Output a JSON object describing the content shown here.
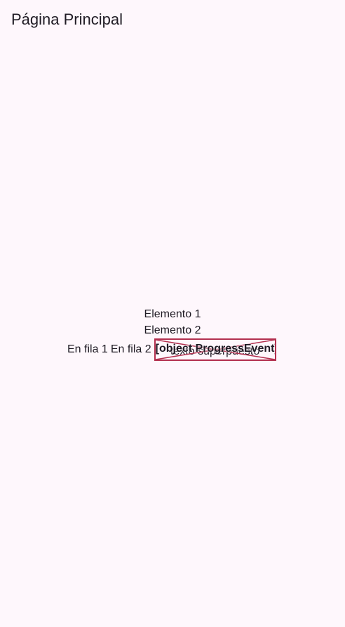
{
  "app_bar": {
    "title": "Página Principal"
  },
  "column": {
    "items": [
      "Elemento 1",
      "Elemento 2"
    ]
  },
  "row": {
    "item_1": "En fila 1",
    "item_2": "En fila 2",
    "stack": {
      "underlay_text": "texto superpuesto",
      "broken_image_label": "[object ProgressEvent]"
    }
  },
  "colors": {
    "background": "#fef7fc",
    "text": "#1f1b24",
    "error_border": "#b3304f"
  }
}
